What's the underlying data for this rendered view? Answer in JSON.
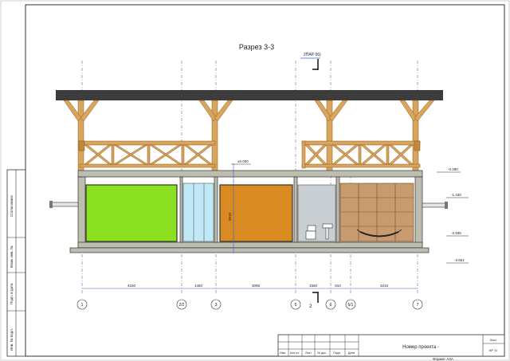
{
  "title": "Разрез 3-3",
  "section_marker": "2ПАР 06)",
  "grid_axes": [
    "1",
    "2/2",
    "3",
    "5",
    "6",
    "6/1",
    "7"
  ],
  "section_cut_number": "2",
  "dimensions": [
    "4150",
    "1450",
    "3095",
    "1560",
    "910",
    "3315"
  ],
  "vertical_dimension": "3010",
  "levels": {
    "top_floor": "±0.000",
    "right_upper": "-0.290",
    "right_mid": "-1.430",
    "right_low": "-2.935",
    "right_bottom": "-3.651"
  },
  "side_stamp_labels": [
    "Согласовано",
    "Взам. инв. №",
    "Подп. и дата",
    "Инв. № подл."
  ],
  "title_block": {
    "columns": [
      "Изм.",
      "Кол.уч.",
      "Лист",
      "№ док.",
      "Подп.",
      "Дата"
    ],
    "project_number": "Номер проекта -",
    "sheet_label": "Лист",
    "sheet_number": "АР 11"
  },
  "format_label": "Формат А3А",
  "colors": {
    "roof": "#3c3c3c",
    "timber": "#d9a45c",
    "concrete": "#bdbdb0",
    "green_room": "#8be11f",
    "glass": "#bfe9f7",
    "orange_room": "#d98a20",
    "wc_room": "#c9ced3",
    "wood_panel": "#c79b6e",
    "dimension_line": "#3a5fd0"
  },
  "icons": [
    "toilet-icon",
    "sink-icon",
    "hammock-icon"
  ]
}
